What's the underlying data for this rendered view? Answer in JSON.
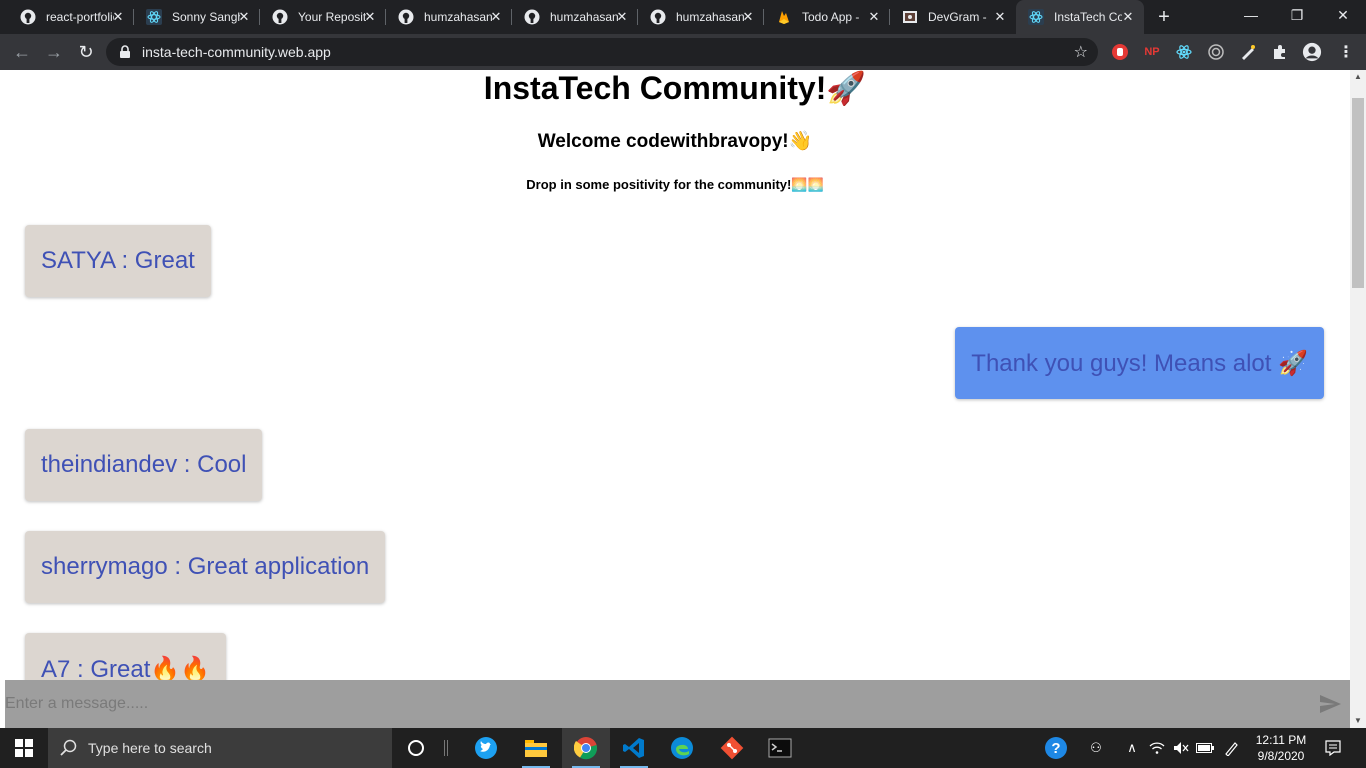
{
  "browser": {
    "tabs": [
      {
        "title": "react-portfolio",
        "icon": "github-icon"
      },
      {
        "title": "Sonny Sangha",
        "icon": "react-icon"
      },
      {
        "title": "Your Repositories",
        "icon": "github-icon"
      },
      {
        "title": "humzahasan",
        "icon": "github-icon"
      },
      {
        "title": "humzahasan",
        "icon": "github-icon"
      },
      {
        "title": "humzahasan",
        "icon": "github-icon"
      },
      {
        "title": "Todo App -",
        "icon": "firebase-icon"
      },
      {
        "title": "DevGram -",
        "icon": "devgram-icon"
      },
      {
        "title": "InstaTech Community",
        "icon": "react-icon"
      }
    ],
    "active_tab_index": 8,
    "url": "insta-tech-community.web.app",
    "extensions": [
      "stop-extension-icon",
      "np-extension-icon",
      "react-devtools-icon",
      "circle-extension-icon",
      "pen-extension-icon",
      "puzzle-icon",
      "profile-avatar"
    ],
    "np_label": "NP"
  },
  "page": {
    "title": "InstaTech Community!🚀",
    "welcome": "Welcome codewithbravopy!👋",
    "subtitle": "Drop in some positivity for the community!🌅🌅",
    "messages": [
      {
        "text": "SATYA : Great",
        "own": false
      },
      {
        "text": "Thank you guys! Means alot 🚀",
        "own": true
      },
      {
        "text": "theindiandev : Cool",
        "own": false
      },
      {
        "text": "sherrymago : Great application",
        "own": false
      },
      {
        "text": "A7 : Great🔥🔥",
        "own": false
      }
    ],
    "composer": {
      "placeholder": "Enter a message....."
    }
  },
  "taskbar": {
    "search_label": "Type here to search",
    "apps": [
      "cortana-icon",
      "twitter-icon",
      "file-explorer-icon",
      "chrome-icon",
      "vscode-icon",
      "edge-icon",
      "git-icon",
      "terminal-icon"
    ],
    "time": "12:11 PM",
    "date": "9/8/2020"
  },
  "colors": {
    "message_bg": "#dcd6d0",
    "own_message_bg": "#5e91ee",
    "message_text": "#3f51b5",
    "composer_bg": "#9e9e9e"
  }
}
